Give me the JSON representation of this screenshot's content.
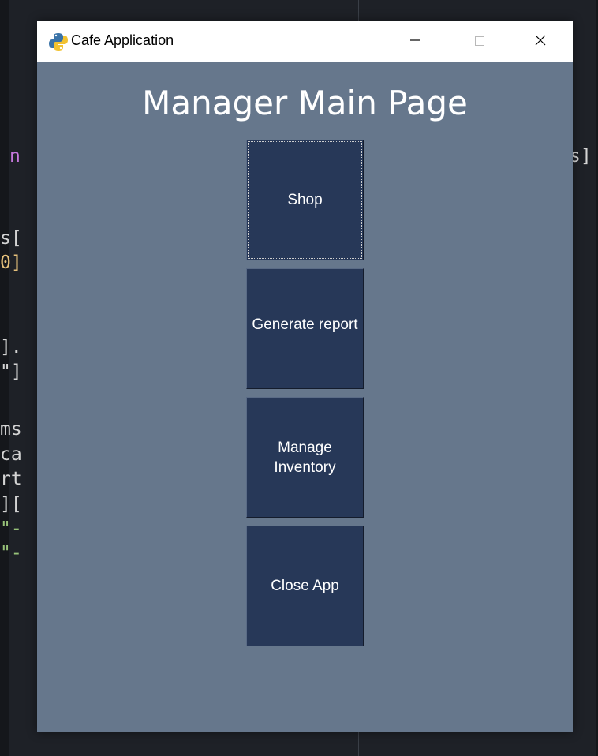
{
  "window": {
    "title": "Cafe Application"
  },
  "page": {
    "heading": "Manager Main Page"
  },
  "buttons": {
    "shop": "Shop",
    "report": "Generate report",
    "inventory": "Manage\nInventory",
    "close": "Close App"
  },
  "background_code": [
    {
      "text": "n ",
      "color": "#c678dd"
    },
    {
      "text": "s[",
      "color": "#d4d4d4"
    },
    {
      "text": "0]",
      "color": "#e5c07b"
    },
    {
      "text": "].",
      "color": "#d4d4d4"
    },
    {
      "text": "\"]",
      "color": "#d4d4d4"
    },
    {
      "text": "ms",
      "color": "#d4d4d4"
    },
    {
      "text": "ca",
      "color": "#d4d4d4"
    },
    {
      "text": "rt",
      "color": "#d4d4d4"
    },
    {
      "text": "][",
      "color": "#d4d4d4"
    },
    {
      "text": "\"-",
      "color": "#98c379"
    },
    {
      "text": "\"-",
      "color": "#98c379"
    },
    {
      "text": "s]",
      "color": "#d4d4d4"
    }
  ],
  "icons": {
    "app": "python-icon",
    "minimize": "minimize-icon",
    "maximize": "maximize-icon",
    "close": "close-icon"
  },
  "colors": {
    "window_bg": "#66778c",
    "button_bg": "#273858",
    "heading": "#ffffff"
  }
}
